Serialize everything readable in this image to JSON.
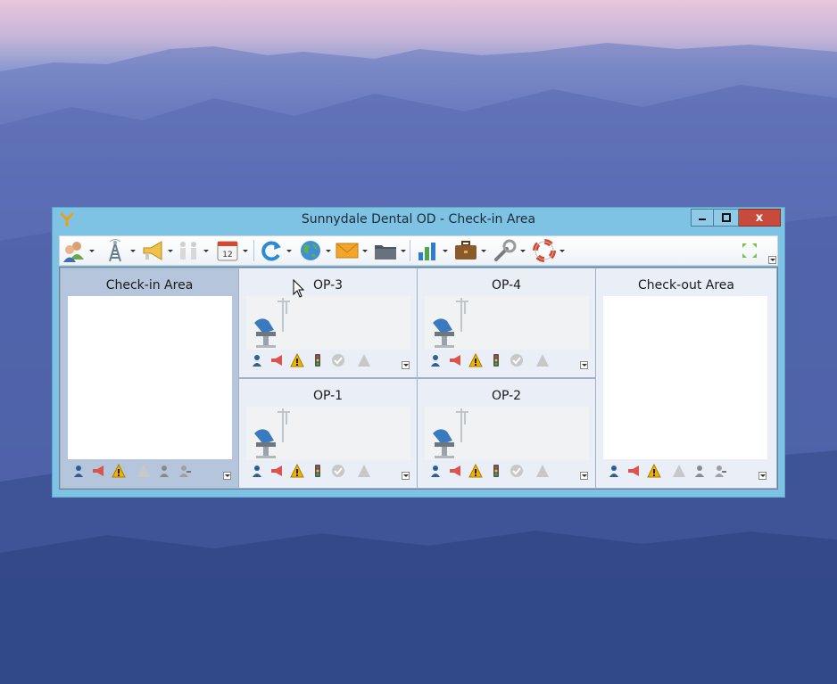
{
  "window": {
    "title": "Sunnydale Dental OD - Check-in Area",
    "close_glyph": "x"
  },
  "toolbar": {
    "items": [
      {
        "name": "patients-icon"
      },
      {
        "name": "tower-icon"
      },
      {
        "name": "megaphone-icon"
      },
      {
        "name": "people-icon"
      },
      {
        "name": "calendar-icon",
        "text": "12"
      },
      {
        "name": "refresh-icon"
      },
      {
        "name": "globe-icon"
      },
      {
        "name": "mail-icon"
      },
      {
        "name": "folder-icon"
      },
      {
        "name": "chart-icon"
      },
      {
        "name": "briefcase-icon"
      },
      {
        "name": "tools-icon"
      },
      {
        "name": "lifebuoy-icon"
      }
    ]
  },
  "areas": {
    "checkin": {
      "title": "Check-in Area"
    },
    "op3": {
      "title": "OP-3"
    },
    "op4": {
      "title": "OP-4"
    },
    "op1": {
      "title": "OP-1"
    },
    "op2": {
      "title": "OP-2"
    },
    "checkout": {
      "title": "Check-out Area"
    }
  },
  "colors": {
    "titlebar": "#7fc3e4",
    "close": "#c74a3d",
    "area_header": "#e9eef7",
    "selected_area": "#b4c5dc"
  }
}
